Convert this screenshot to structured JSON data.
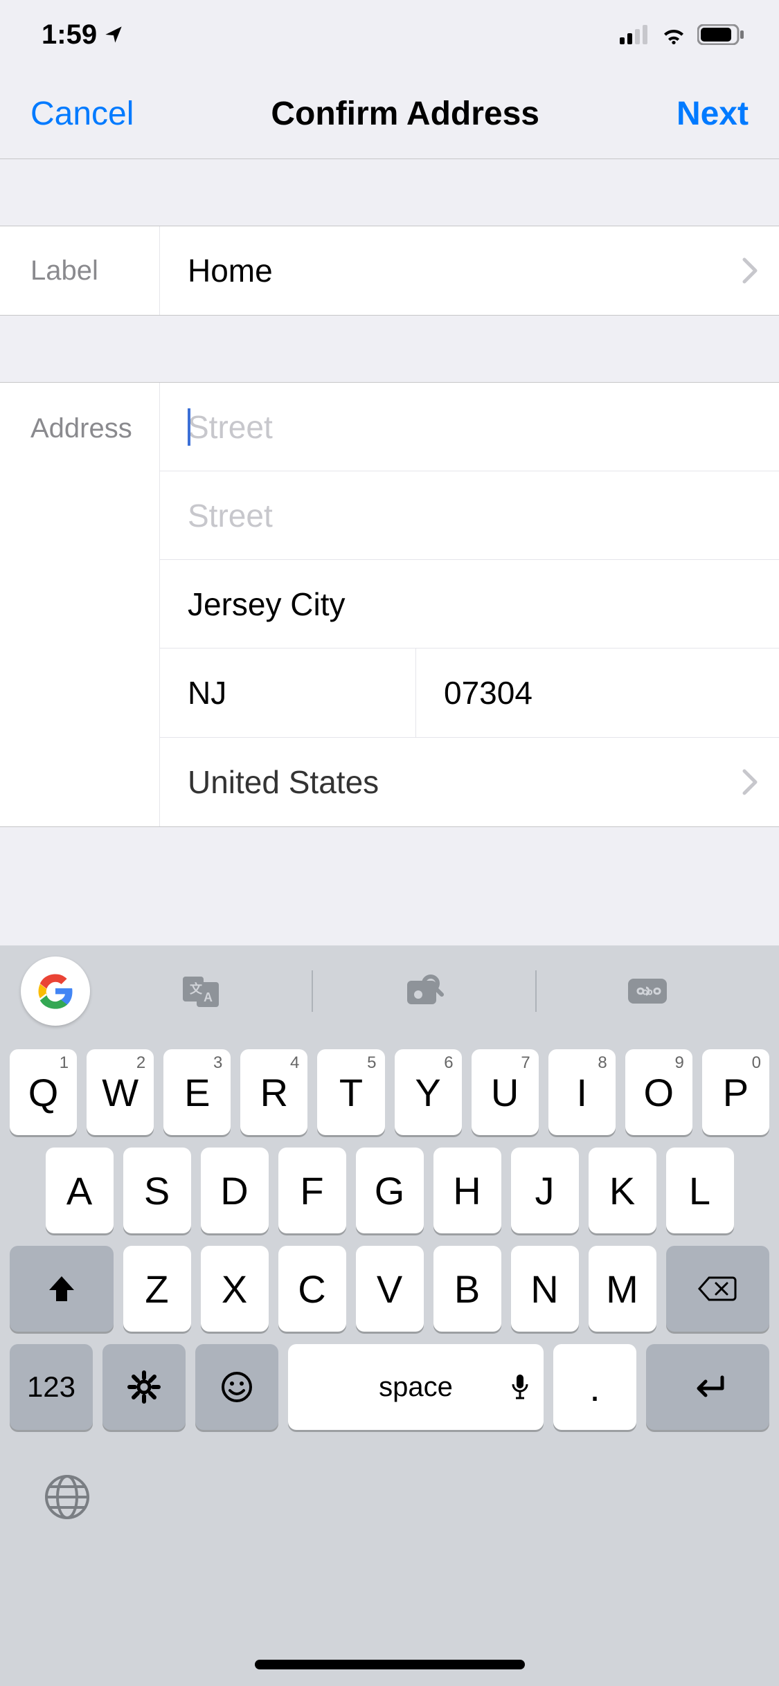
{
  "status": {
    "time": "1:59"
  },
  "nav": {
    "cancel": "Cancel",
    "title": "Confirm Address",
    "next": "Next"
  },
  "label_section": {
    "label_text": "Label",
    "value": "Home"
  },
  "address_section": {
    "side_label": "Address",
    "street1_placeholder": "Street",
    "street1_value": "",
    "street2_placeholder": "Street",
    "street2_value": "",
    "city": "Jersey City",
    "state": "NJ",
    "postal": "07304",
    "country": "United States"
  },
  "keyboard": {
    "rows": [
      [
        {
          "k": "Q",
          "n": "1"
        },
        {
          "k": "W",
          "n": "2"
        },
        {
          "k": "E",
          "n": "3"
        },
        {
          "k": "R",
          "n": "4"
        },
        {
          "k": "T",
          "n": "5"
        },
        {
          "k": "Y",
          "n": "6"
        },
        {
          "k": "U",
          "n": "7"
        },
        {
          "k": "I",
          "n": "8"
        },
        {
          "k": "O",
          "n": "9"
        },
        {
          "k": "P",
          "n": "0"
        }
      ],
      [
        {
          "k": "A"
        },
        {
          "k": "S"
        },
        {
          "k": "D"
        },
        {
          "k": "F"
        },
        {
          "k": "G"
        },
        {
          "k": "H"
        },
        {
          "k": "J"
        },
        {
          "k": "K"
        },
        {
          "k": "L"
        }
      ],
      [
        {
          "k": "Z"
        },
        {
          "k": "X"
        },
        {
          "k": "C"
        },
        {
          "k": "V"
        },
        {
          "k": "B"
        },
        {
          "k": "N"
        },
        {
          "k": "M"
        }
      ]
    ],
    "space": "space",
    "numbers": "123",
    "dot": "."
  }
}
